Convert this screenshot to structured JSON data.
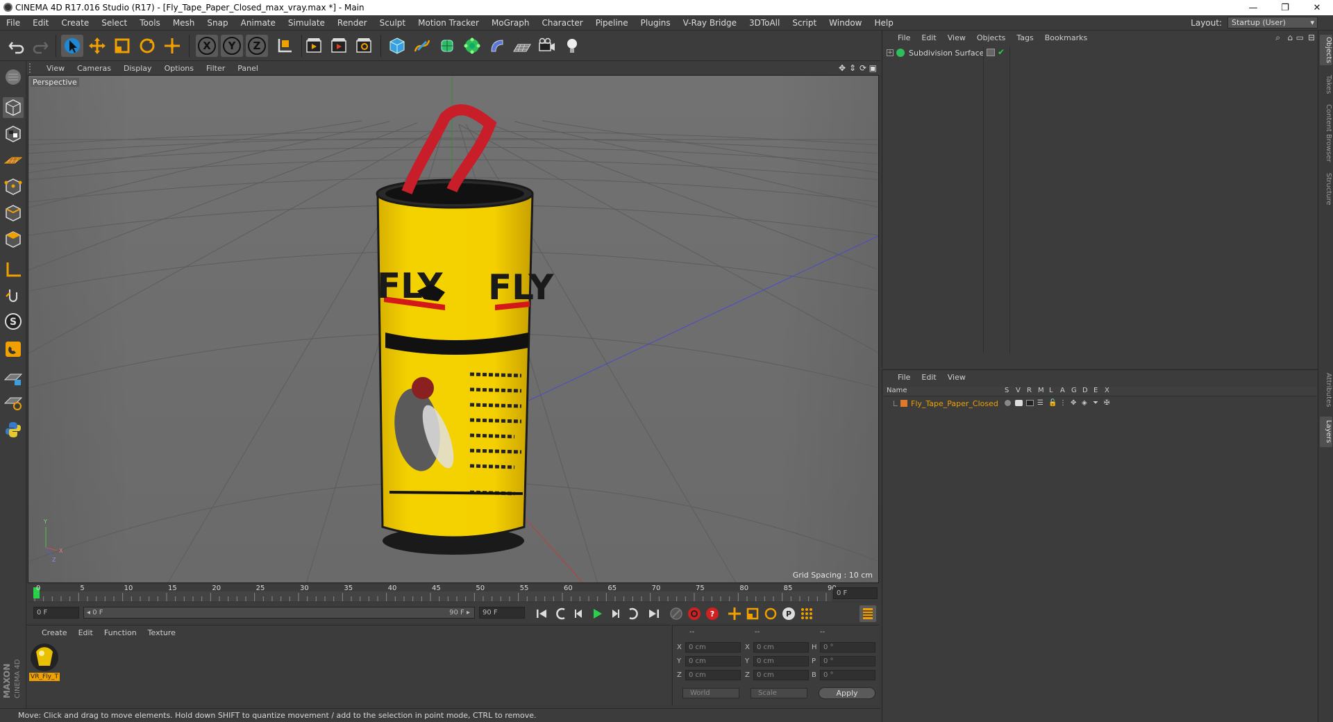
{
  "window": {
    "title": "CINEMA 4D R17.016 Studio (R17) - [Fly_Tape_Paper_Closed_max_vray.max *] - Main",
    "minimize": "—",
    "maximize": "❐",
    "close": "✕"
  },
  "menubar": {
    "items": [
      "File",
      "Edit",
      "Create",
      "Select",
      "Tools",
      "Mesh",
      "Snap",
      "Animate",
      "Simulate",
      "Render",
      "Sculpt",
      "Motion Tracker",
      "MoGraph",
      "Character",
      "Pipeline",
      "Plugins",
      "V-Ray Bridge",
      "3DToAll",
      "Script",
      "Window",
      "Help"
    ],
    "layout_label": "Layout:",
    "layout_value": "Startup (User)"
  },
  "viewport": {
    "menu": [
      "View",
      "Cameras",
      "Display",
      "Options",
      "Filter",
      "Panel"
    ],
    "label": "Perspective",
    "grid_spacing": "Grid Spacing : 10 cm",
    "model_text": "FLY",
    "model_text_2": "FLY",
    "axis_y": "Y",
    "axis_x": "X",
    "axis_z": "Z"
  },
  "timeline": {
    "ticks": [
      "0",
      "5",
      "10",
      "15",
      "20",
      "25",
      "30",
      "35",
      "40",
      "45",
      "50",
      "55",
      "60",
      "65",
      "70",
      "75",
      "80",
      "85",
      "90"
    ],
    "current_frame": "0 F",
    "start_field": "0 F",
    "range_start": "◂ 0 F",
    "range_end": "90 F ▸",
    "end_field": "90 F"
  },
  "material_panel": {
    "menu": [
      "Create",
      "Edit",
      "Function",
      "Texture"
    ],
    "material_name": "VR_Fly_T"
  },
  "coord_panel": {
    "header": [
      "--",
      "--",
      "--"
    ],
    "rows": [
      {
        "l1": "X",
        "v1": "0 cm",
        "l2": "X",
        "v2": "0 cm",
        "l3": "H",
        "v3": "0 °"
      },
      {
        "l1": "Y",
        "v1": "0 cm",
        "l2": "Y",
        "v2": "0 cm",
        "l3": "P",
        "v3": "0 °"
      },
      {
        "l1": "Z",
        "v1": "0 cm",
        "l2": "Z",
        "v2": "0 cm",
        "l3": "B",
        "v3": "0 °"
      }
    ],
    "world": "World",
    "scale": "Scale",
    "apply": "Apply"
  },
  "statusbar": {
    "text": "Move: Click and drag to move elements. Hold down SHIFT to quantize movement / add to the selection in point mode, CTRL to remove."
  },
  "object_manager": {
    "menu": [
      "File",
      "Edit",
      "View",
      "Objects",
      "Tags",
      "Bookmarks"
    ],
    "objects": [
      {
        "name": "Subdivision Surface"
      }
    ]
  },
  "layer_manager": {
    "menu": [
      "File",
      "Edit",
      "View"
    ],
    "columns": [
      "Name",
      "S",
      "V",
      "R",
      "M",
      "L",
      "A",
      "G",
      "D",
      "E",
      "X"
    ],
    "layers": [
      {
        "name": "Fly_Tape_Paper_Closed",
        "color": "#e0782a"
      }
    ]
  },
  "right_tabs": [
    "Objects",
    "Takes",
    "Content Browser",
    "Structure",
    "Attributes",
    "Layers"
  ],
  "brand": {
    "line1": "MAXON",
    "line2": "CINEMA 4D"
  },
  "colors": {
    "accent_orange": "#f0a000",
    "active_green": "#29d14a",
    "bg_dark": "#3c3c3c",
    "viewport_bg": "#6e6e6e"
  }
}
